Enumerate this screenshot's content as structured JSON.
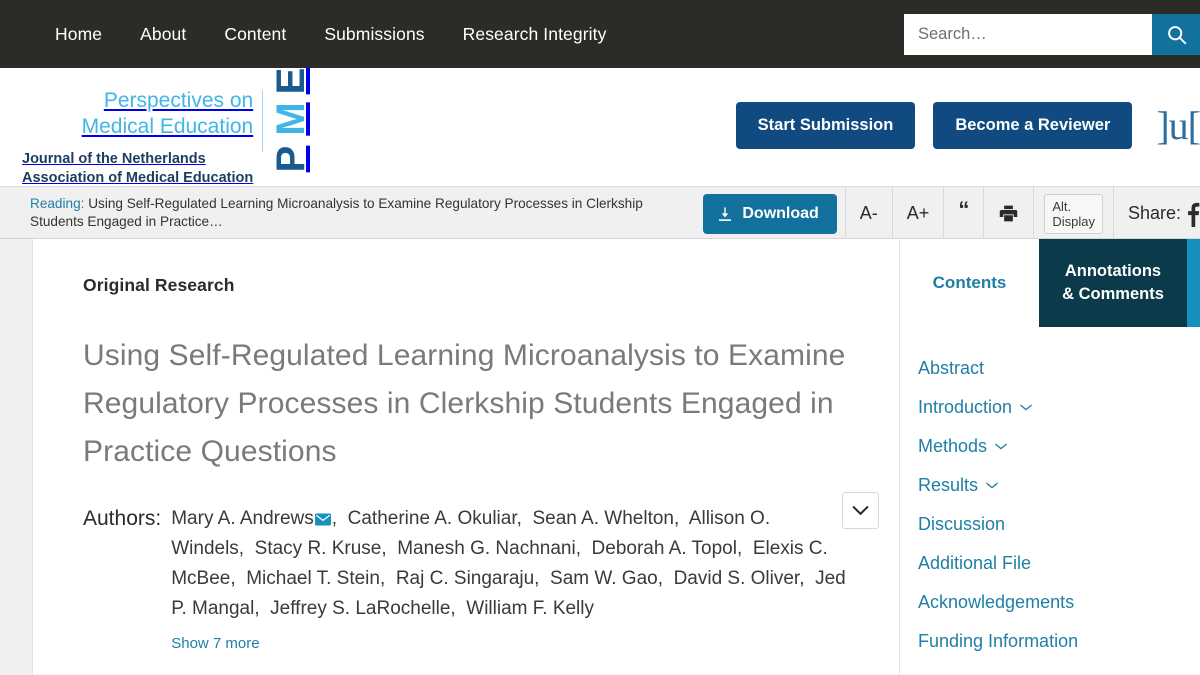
{
  "nav": {
    "items": [
      {
        "label": "Home"
      },
      {
        "label": "About"
      },
      {
        "label": "Content"
      },
      {
        "label": "Submissions"
      },
      {
        "label": "Research Integrity"
      }
    ]
  },
  "search": {
    "placeholder": "Search…",
    "value": "",
    "icon": "search-icon"
  },
  "brand": {
    "line1": "Perspectives on",
    "line2": "Medical Education",
    "sub1": "Journal of the Netherlands",
    "sub2": "Association of Medical Education",
    "mark": {
      "p": "P",
      "m": "M",
      "e": "E"
    },
    "publisher_mark": "]u[",
    "colors": {
      "light_blue": "#41b6e6",
      "dark_blue": "#1b5a8e",
      "button_blue": "#114a80",
      "teal": "#12719d",
      "nav_dark": "#2b2b28",
      "tab_dark": "#0b3a4a",
      "link_teal": "#1f7fa5"
    }
  },
  "brand_actions": {
    "start_submission": "Start Submission",
    "become_reviewer": "Become a Reviewer"
  },
  "toolbar": {
    "reading_label": "Reading:",
    "reading_title": "Using Self-Regulated Learning Microanalysis to Examine Regulatory Processes in Clerkship Students Engaged in Practice…",
    "download": "Download",
    "font_decrease": "A-",
    "font_increase": "A+",
    "cite": "“",
    "print_icon": "printer-icon",
    "alt_display_line1": "Alt.",
    "alt_display_line2": "Display",
    "share_label": "Share:",
    "share_facebook": "facebook-icon"
  },
  "article": {
    "kicker": "Original Research",
    "title": "Using Self-Regulated Learning Microanalysis to Examine Regulatory Processes in Clerkship Students Engaged in Practice Questions",
    "authors_label": "Authors:",
    "authors": [
      "Mary A. Andrews",
      "Catherine A. Okuliar",
      "Sean A. Whelton",
      "Allison O. Windels",
      "Stacy R. Kruse",
      "Manesh G. Nachnani",
      "Deborah A. Topol",
      "Elexis C. McBee",
      "Michael T. Stein",
      "Raj C. Singaraju",
      "Sam W. Gao",
      "David S. Oliver",
      "Jed P. Mangal",
      "Jeffrey S. LaRochelle",
      "William F. Kelly"
    ],
    "corresponding_author_icon": "envelope-icon",
    "show_more": "Show 7 more",
    "collapse_icon": "chevron-down-icon"
  },
  "sidebar": {
    "tab_contents": "Contents",
    "tab_annotations_line1": "Annotations",
    "tab_annotations_line2": "& Comments",
    "toc": [
      {
        "label": "Abstract",
        "expandable": false
      },
      {
        "label": "Introduction",
        "expandable": true
      },
      {
        "label": "Methods",
        "expandable": true
      },
      {
        "label": "Results",
        "expandable": true
      },
      {
        "label": "Discussion",
        "expandable": false
      },
      {
        "label": "Additional File",
        "expandable": false
      },
      {
        "label": "Acknowledgements",
        "expandable": false
      },
      {
        "label": "Funding Information",
        "expandable": false
      }
    ]
  }
}
